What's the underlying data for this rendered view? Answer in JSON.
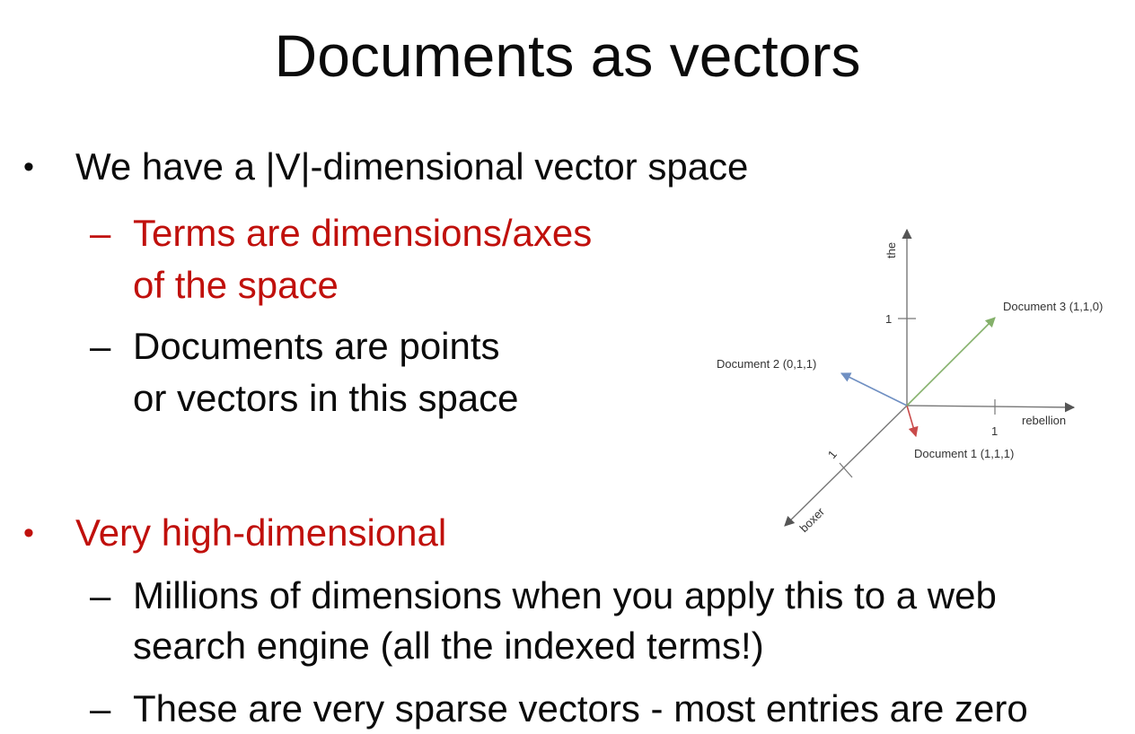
{
  "slide": {
    "title": "Documents as vectors",
    "bullets": [
      {
        "marker": "•",
        "text": "We have a |V|-dimensional vector space",
        "subitems": [
          {
            "marker": "–",
            "lines": [
              "Terms are dimensions/axes",
              "of the space"
            ]
          },
          {
            "marker": "–",
            "lines": [
              "Documents are points",
              "or vectors in this space"
            ]
          }
        ]
      },
      {
        "marker": "•",
        "text": "Very high-dimensional",
        "subitems": [
          {
            "marker": "–",
            "lines": [
              "Millions of dimensions when you apply this to a web",
              "search engine (all the indexed terms!)"
            ]
          },
          {
            "marker": "–",
            "lines": [
              "These are very sparse vectors - most entries are zero"
            ]
          }
        ]
      }
    ],
    "colors": {
      "text": "#0b0b0b",
      "emphasis": "#c0100c"
    }
  },
  "diagram": {
    "axes": {
      "vertical": "the",
      "horizontal": "rebellion",
      "diagonal": "boxer"
    },
    "ticks": {
      "vertical": "1",
      "horizontal": "1",
      "diagonal": "1"
    },
    "vectors": [
      {
        "label": "Document 1 (1,1,1)",
        "color": "#c94a4a"
      },
      {
        "label": "Document 2 (0,1,1)",
        "color": "#6f8fc2"
      },
      {
        "label": "Document 3 (1,1,0)",
        "color": "#84b06a"
      }
    ]
  }
}
